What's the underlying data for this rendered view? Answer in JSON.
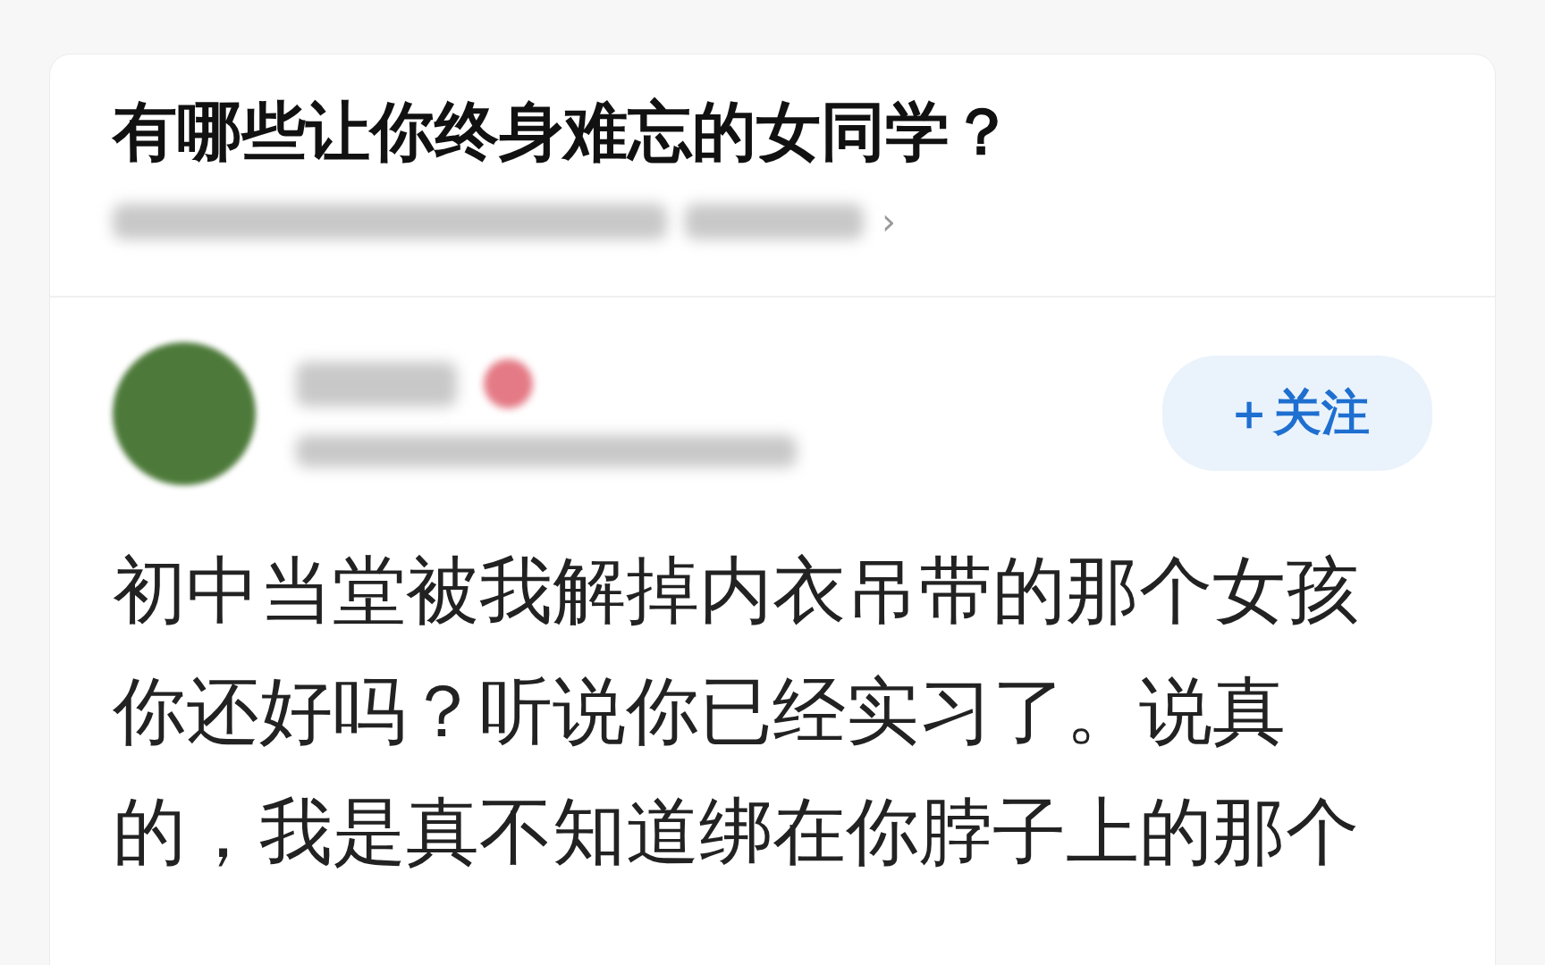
{
  "question": {
    "title": "有哪些让你终身难忘的女同学？",
    "meta_chevron": "›"
  },
  "answer": {
    "follow_button": "＋关注",
    "body": "初中当堂被我解掉内衣吊带的那个女孩你还好吗？听说你已经实习了。说真的，我是真不知道绑在你脖子上的那个"
  }
}
